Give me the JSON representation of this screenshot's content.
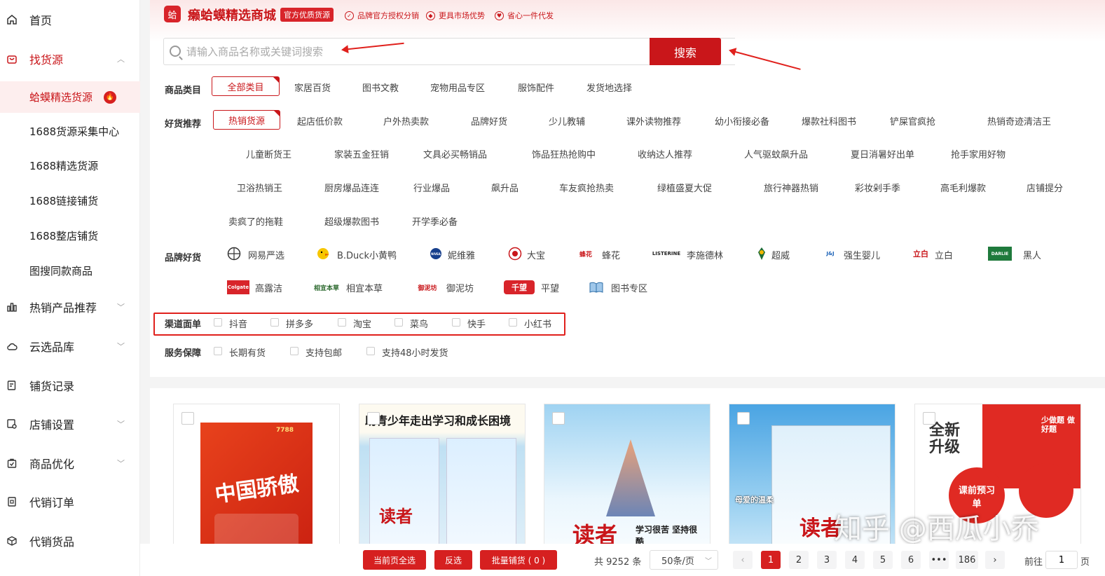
{
  "sidebar": {
    "home": "首页",
    "find_source": "找货源",
    "sub_items": [
      "蛤蟆精选货源",
      "1688货源采集中心",
      "1688精选货源",
      "1688链接铺货",
      "1688整店铺货",
      "图搜同款商品"
    ],
    "hot_products": "热销产品推荐",
    "cloud_library": "云选品库",
    "listing_records": "铺货记录",
    "store_settings": "店铺设置",
    "product_optimize": "商品优化",
    "consign_orders": "代销订单",
    "consign_goods": "代销货品"
  },
  "header": {
    "logo_glyph": "蛤",
    "brand_title": "癞蛤蟆精选商城",
    "official_badge": "官方优质货源",
    "benefits": [
      "品牌官方授权分销",
      "更具市场优势",
      "省心一件代发"
    ]
  },
  "search": {
    "placeholder": "请输入商品名称或关键词搜索",
    "button": "搜索"
  },
  "filters": {
    "category_label": "商品类目",
    "categories": [
      "全部类目",
      "家居百货",
      "图书文教",
      "宠物用品专区",
      "服饰配件",
      "发货地选择"
    ],
    "recommend_label": "好货推荐",
    "recommend_selected": "热销货源",
    "recommend_row1": [
      "起店低价款",
      "户外热卖款",
      "品牌好货",
      "少儿教辅",
      "课外读物推荐",
      "幼小衔接必备",
      "爆款社科图书",
      "铲屎官疯抢",
      "热销奇迹清洁王"
    ],
    "recommend_row2": [
      "儿童断货王",
      "家装五金狂销",
      "文具必买畅销品",
      "饰品狂热抢购中",
      "收纳达人推荐",
      "人气驱蚊飙升品",
      "夏日消暑好出单",
      "抢手家用好物"
    ],
    "recommend_row3": [
      "卫浴热销王",
      "厨房爆品连连",
      "行业爆品",
      "飙升品",
      "车友疯抢热卖",
      "绿植盛夏大促",
      "旅行神器热销",
      "彩妆剁手季",
      "高毛利爆款",
      "店铺提分"
    ],
    "recommend_row4": [
      "卖疯了的拖鞋",
      "超级爆款图书",
      "开学季必备"
    ],
    "brand_label": "品牌好货",
    "brands_row1": [
      "网易严选",
      "B.Duck小黄鸭",
      "妮维雅",
      "大宝",
      "蜂花",
      "李施德林",
      "超威",
      "强生婴儿",
      "立白",
      "黑人"
    ],
    "brands_row2": [
      "高露洁",
      "相宜本草",
      "御泥坊",
      "平望",
      "图书专区"
    ],
    "brand_logos": {
      "neteaselogo": "网易",
      "nivea": "NIVEA",
      "dabao": "宝",
      "fenghua": "蜂花",
      "listerine": "LISTERINE",
      "liby": "立白",
      "darlie": "DARLIE",
      "colgate": "Colgate",
      "xiangyi": "相宜本草",
      "yunifang": "御泥坊",
      "pingwang": "千望"
    },
    "channel_label": "渠道面单",
    "channels": [
      "抖音",
      "拼多多",
      "淘宝",
      "菜鸟",
      "快手",
      "小红书"
    ],
    "service_label": "服务保障",
    "services": [
      "长期有货",
      "支持包邮",
      "支持48小时发货"
    ]
  },
  "products": {
    "covers": [
      {
        "line1": "中国骄傲",
        "brand": "7788"
      },
      {
        "line1": "助青少年走出学习和成长困境",
        "line2": "读者"
      },
      {
        "line1": "读者",
        "line2": "学习很苦 坚持很酷"
      },
      {
        "line1": "读者",
        "line2": "母爱的温柔"
      },
      {
        "line1": "全新升级",
        "line2": "课前预习单",
        "tag": "少做题 做好题"
      }
    ]
  },
  "bottom": {
    "select_page": "当前页全选",
    "invert": "反选",
    "batch_list": "批量铺货 ( 0 )",
    "total": "共 9252 条",
    "per_page": "50条/页",
    "pages": [
      "1",
      "2",
      "3",
      "4",
      "5",
      "6",
      "•••",
      "186"
    ],
    "goto_label": "前往",
    "goto_value": "1",
    "page_unit": "页"
  },
  "watermark": "知乎 @西瓜小乔",
  "colors": {
    "accent": "#c9161a",
    "annotation_red": "#e0201c"
  }
}
